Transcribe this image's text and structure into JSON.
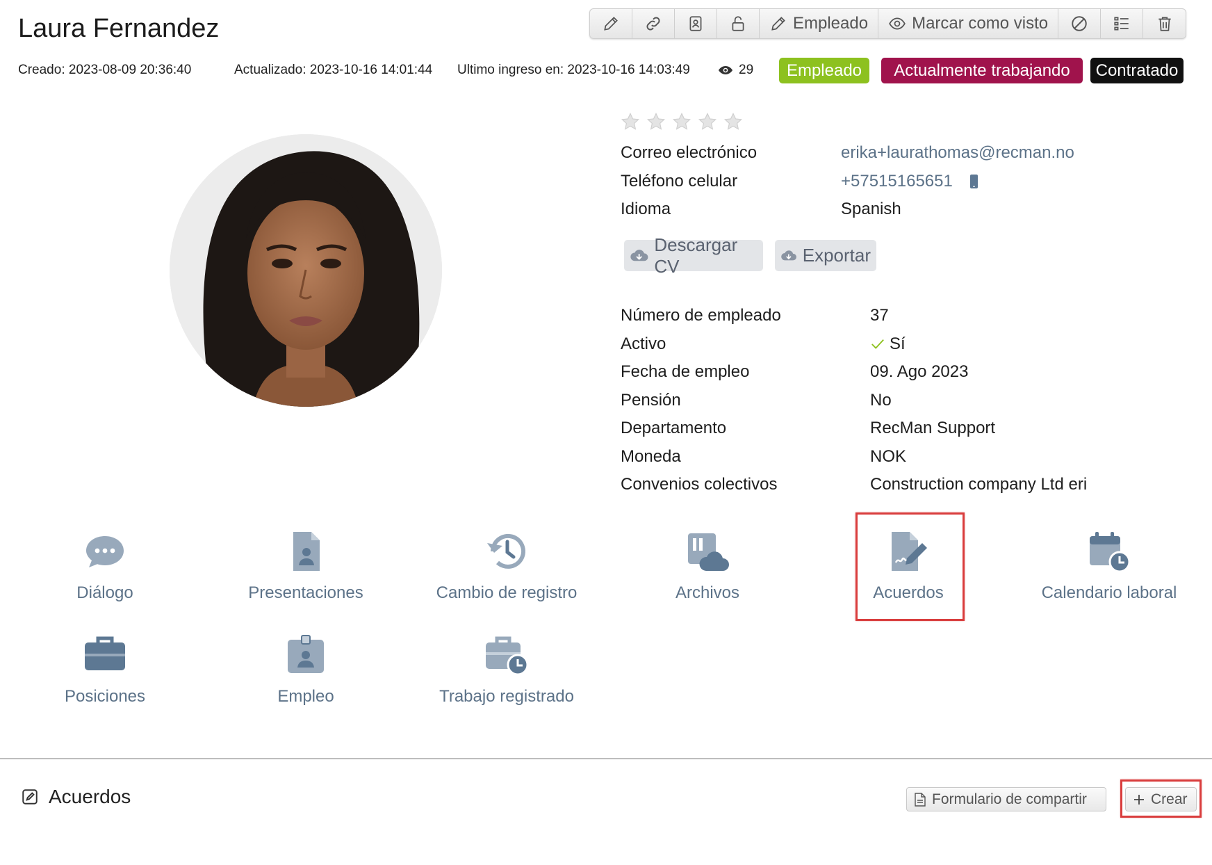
{
  "header": {
    "name": "Laura Fernandez",
    "created": "Creado: 2023-08-09 20:36:40",
    "updated": "Actualizado: 2023-10-16 14:01:44",
    "last_login": "Ultimo ingreso en: 2023-10-16 14:03:49",
    "views": "29"
  },
  "toolbar": {
    "employee_label": "Empleado",
    "mark_seen_label": "Marcar como visto"
  },
  "badges": [
    {
      "label": "Empleado",
      "color": "#8dc11f"
    },
    {
      "label": "Actualmente trabajando",
      "color": "#a0134c"
    },
    {
      "label": "Contratado",
      "color": "#111111"
    }
  ],
  "rating": {
    "value": 0,
    "max": 5
  },
  "contact": {
    "email_label": "Correo electrónico",
    "email": "erika+laurathomas@recman.no",
    "phone_label": "Teléfono celular",
    "phone": "+57515165651",
    "language_label": "Idioma",
    "language": "Spanish"
  },
  "actions": {
    "download_cv": "Descargar CV",
    "export": "Exportar"
  },
  "details": [
    {
      "label": "Número de empleado",
      "value": "37"
    },
    {
      "label": "Activo",
      "value": "Sí"
    },
    {
      "label": "Fecha de empleo",
      "value": "09. Ago 2023"
    },
    {
      "label": "Pensión",
      "value": "No"
    },
    {
      "label": "Departamento",
      "value": "RecMan Support"
    },
    {
      "label": "Moneda",
      "value": "NOK"
    },
    {
      "label": "Convenios colectivos",
      "value": "Construction company Ltd eri"
    }
  ],
  "tiles": [
    {
      "label": "Diálogo",
      "icon": "chat-bubble-icon"
    },
    {
      "label": "Presentaciones",
      "icon": "person-document-icon"
    },
    {
      "label": "Cambio de registro",
      "icon": "history-icon"
    },
    {
      "label": "Archivos",
      "icon": "files-cloud-icon"
    },
    {
      "label": "Acuerdos",
      "icon": "signed-document-icon"
    },
    {
      "label": "Calendario laboral",
      "icon": "calendar-clock-icon"
    },
    {
      "label": "Posiciones",
      "icon": "briefcase-icon"
    },
    {
      "label": "Empleo",
      "icon": "id-badge-icon"
    },
    {
      "label": "Trabajo registrado",
      "icon": "briefcase-clock-icon"
    }
  ],
  "section": {
    "title": "Acuerdos",
    "share_form": "Formulario de compartir",
    "create": "Crear"
  },
  "colors": {
    "accent_text": "#5c7288",
    "icon_fill": "#5d7893",
    "highlight": "#d93d3d"
  }
}
